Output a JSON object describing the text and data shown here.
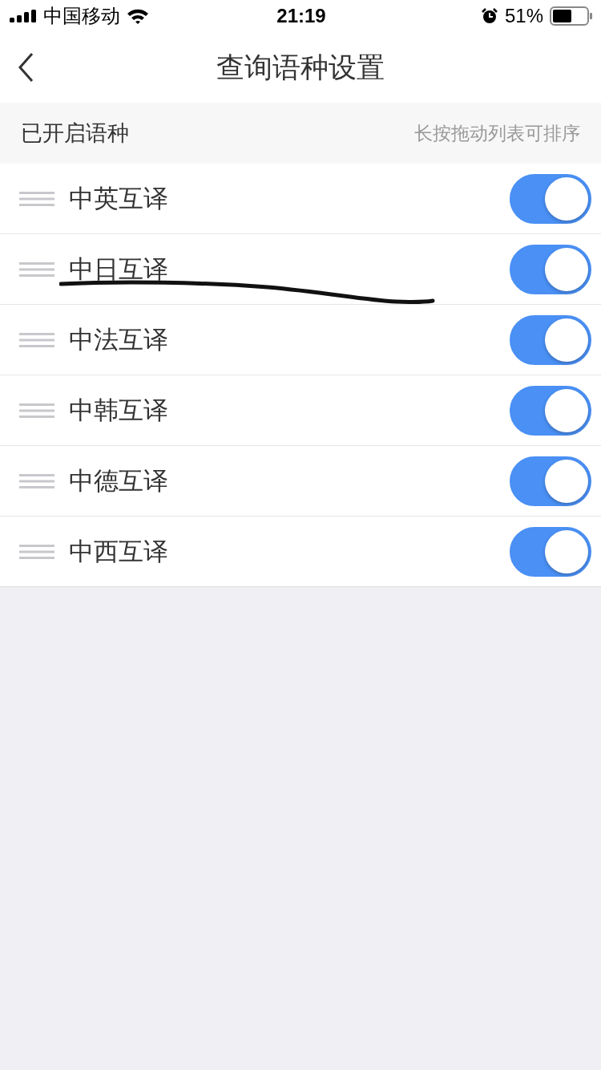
{
  "status_bar": {
    "carrier": "中国移动",
    "time": "21:19",
    "battery": "51%"
  },
  "nav": {
    "title": "查询语种设置"
  },
  "section": {
    "title": "已开启语种",
    "hint": "长按拖动列表可排序"
  },
  "rows": [
    {
      "label": "中英互译",
      "on": true
    },
    {
      "label": "中日互译",
      "on": true
    },
    {
      "label": "中法互译",
      "on": true
    },
    {
      "label": "中韩互译",
      "on": true
    },
    {
      "label": "中德互译",
      "on": true
    },
    {
      "label": "中西互译",
      "on": true
    }
  ]
}
